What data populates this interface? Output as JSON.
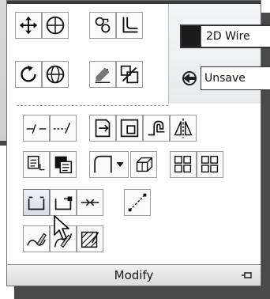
{
  "view_controls": {
    "visual_style": "2D Wire",
    "saved_view": "Unsave"
  },
  "panel": {
    "title": "Modify"
  },
  "tools": [
    "move-icon",
    "rotate-icon",
    "copy-icon",
    "mirror-icon",
    "stretch-icon",
    "scale-icon",
    "fillet-icon",
    "array-icon",
    "offset-icon",
    "trim-icon",
    "extend-icon",
    "break-icon",
    "join-icon",
    "chamfer-icon",
    "explode-icon",
    "lengthen-icon",
    "edit-polyline-icon",
    "edit-spline-icon",
    "edit-hatch-icon",
    "align-icon",
    "draw-order-icon",
    "text-to-front-icon",
    "erase-icon",
    "3d-rotate-icon",
    "3d-move-icon",
    "break-at-point-icon",
    "break-two-points-icon",
    "join-line-icon",
    "blend-curves-icon",
    "erase-pencil-icon",
    "reverse-icon",
    "set-to-bylayer-icon",
    "pin-icon",
    "pointer-cursor-icon"
  ],
  "accent_colors": {
    "pressed_button": "#d8dde4",
    "panel_shadow": "#4a4a4a"
  }
}
